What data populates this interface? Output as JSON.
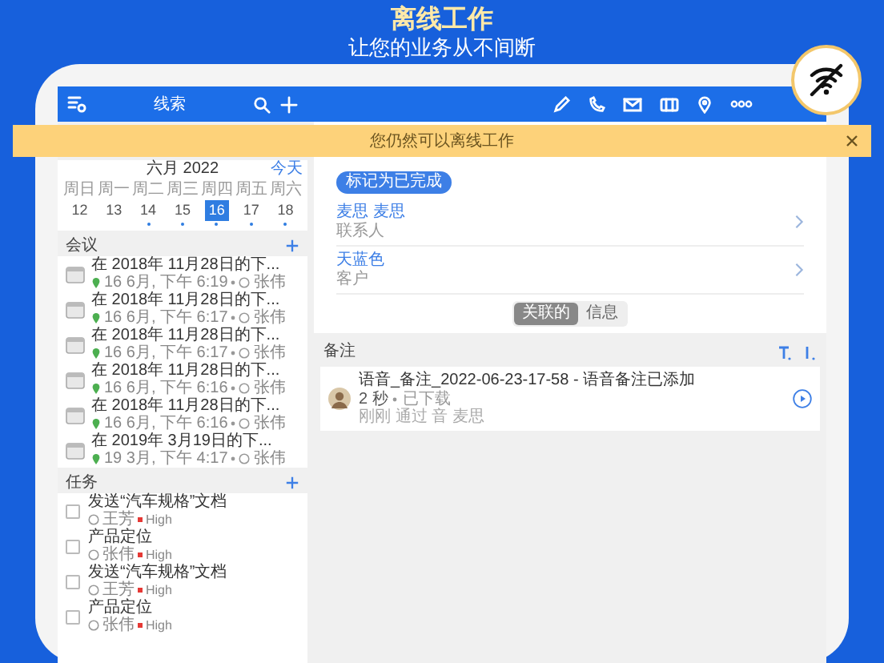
{
  "headline": {
    "title": "离线工作",
    "subtitle": "让您的业务从不间断"
  },
  "toolbar": {
    "title": "线索"
  },
  "banner": {
    "text": "您仍然可以离线工作"
  },
  "calendar": {
    "month": "六月 2022",
    "today": "今天",
    "days": [
      {
        "weekday": "周日",
        "date": "12",
        "has_events": false,
        "selected": false
      },
      {
        "weekday": "周一",
        "date": "13",
        "has_events": false,
        "selected": false
      },
      {
        "weekday": "周二",
        "date": "14",
        "has_events": true,
        "selected": false
      },
      {
        "weekday": "周三",
        "date": "15",
        "has_events": true,
        "selected": false
      },
      {
        "weekday": "周四",
        "date": "16",
        "has_events": true,
        "selected": true
      },
      {
        "weekday": "周五",
        "date": "17",
        "has_events": true,
        "selected": false
      },
      {
        "weekday": "周六",
        "date": "18",
        "has_events": true,
        "selected": false
      }
    ]
  },
  "meetings": {
    "title": "会议",
    "items": [
      {
        "title": "在 2018年 11月28日的下...",
        "time": "16 6月, 下午 6:19",
        "owner": "张伟"
      },
      {
        "title": "在 2018年 11月28日的下...",
        "time": "16 6月, 下午 6:17",
        "owner": "张伟"
      },
      {
        "title": "在 2018年 11月28日的下...",
        "time": "16 6月, 下午 6:17",
        "owner": "张伟"
      },
      {
        "title": "在 2018年 11月28日的下...",
        "time": "16 6月, 下午 6:16",
        "owner": "张伟"
      },
      {
        "title": "在 2018年 11月28日的下...",
        "time": "16 6月, 下午 6:16",
        "owner": "张伟"
      },
      {
        "title": "在 2019年 3月19日的下...",
        "time": "19 3月, 下午 4:17",
        "owner": "张伟"
      }
    ]
  },
  "tasks": {
    "title": "任务",
    "items": [
      {
        "title": "发送“汽车规格”文档",
        "owner": "王芳",
        "priority": "High",
        "checked": false
      },
      {
        "title": "产品定位",
        "owner": "张伟",
        "priority": "High",
        "checked": false
      },
      {
        "title": "发送“汽车规格”文档",
        "owner": "王芳",
        "priority": "High",
        "checked": false
      },
      {
        "title": "产品定位",
        "owner": "张伟",
        "priority": "High",
        "checked": false
      }
    ]
  },
  "detail": {
    "complete_button": "标记为已完成",
    "related": [
      {
        "name": "麦思 麦思",
        "type": "联系人"
      },
      {
        "name": "天蓝色",
        "type": "客户"
      }
    ],
    "tabs": [
      {
        "label": "关联的",
        "selected": true
      },
      {
        "label": "信息",
        "selected": false
      }
    ]
  },
  "notes": {
    "title": "备注",
    "items": [
      {
        "title": "语音_备注_2022-06-23-17-58 - 语音备注已添加",
        "duration": "2 秒",
        "status": "已下载",
        "byline": "刚刚 通过 音 麦思"
      }
    ]
  }
}
